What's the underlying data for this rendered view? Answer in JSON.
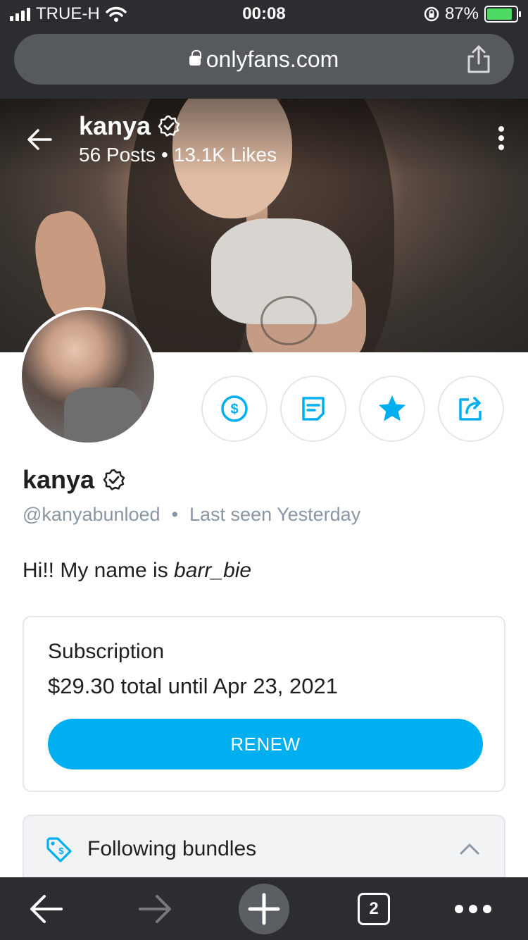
{
  "status": {
    "carrier": "TRUE-H",
    "time": "00:08",
    "battery": "87%"
  },
  "browser": {
    "url": "onlyfans.com",
    "tab_count": "2"
  },
  "cover": {
    "name": "kanya",
    "posts": "56 Posts",
    "dot": "•",
    "likes": "13.1K Likes"
  },
  "profile": {
    "name": "kanya",
    "handle": "@kanyabunloed",
    "separator": "•",
    "last_seen": "Last seen Yesterday",
    "bio_prefix": "Hi!! My name is ",
    "bio_emphasis": "barr_bie"
  },
  "subscription": {
    "title": "Subscription",
    "price": "$29.30 total until Apr 23, 2021",
    "renew_label": "RENEW"
  },
  "bundles": {
    "label": "Following bundles"
  },
  "colors": {
    "accent": "#00aff0",
    "chrome": "#2b2d30",
    "muted": "#8a96a3",
    "verified": "#ffffff"
  },
  "icons": [
    "back-arrow-icon",
    "verified-icon",
    "more-vertical-icon",
    "tip-dollar-icon",
    "message-icon",
    "star-icon",
    "share-icon",
    "price-tag-icon",
    "chevron-up-icon",
    "browser-back-icon",
    "browser-forward-icon",
    "new-tab-plus-icon",
    "tabs-icon",
    "more-horizontal-icon"
  ]
}
